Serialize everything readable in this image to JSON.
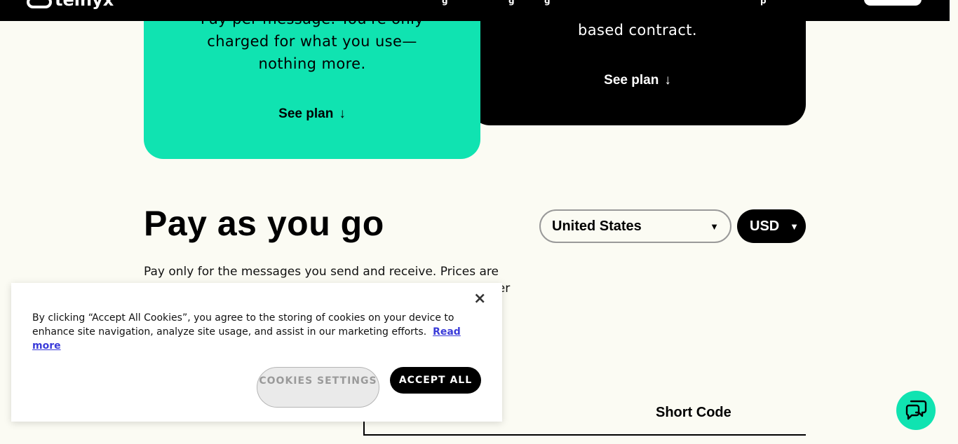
{
  "nav": {
    "logo_text": "telnyx",
    "fragments": [
      "g",
      "g",
      "g",
      "g",
      "p"
    ]
  },
  "cards": {
    "green": {
      "description": "Pay per message. You're only charged for what you use—nothing more.",
      "see_plan": "See plan",
      "arrow": "↓"
    },
    "black": {
      "description": "based contract.",
      "see_plan": "See plan",
      "arrow": "↓"
    }
  },
  "section": {
    "title": "Pay as you go",
    "description": "Pay only for the messages you send and receive. Prices are",
    "description_tail": "ber"
  },
  "selectors": {
    "country": "United States",
    "currency": "USD",
    "caret": "▼"
  },
  "tabs": {
    "partial": "e",
    "short_code": "Short Code"
  },
  "cookie_banner": {
    "text": "By clicking “Accept All Cookies”, you agree to the storing of cookies on your device to enhance site navigation, analyze site usage, and assist in our marketing efforts.",
    "read_more": "Read more",
    "settings_button": "COOKIES SETTINGS",
    "accept_button": "ACCEPT ALL",
    "close": "×"
  },
  "colors": {
    "accent_green": "#10e3b1",
    "page_bg": "#fbfbf3",
    "link_blue": "#3a3bd9"
  },
  "icons": {
    "chat": "chat-bubbles-icon",
    "close": "close-icon",
    "arrow": "arrow-down-icon"
  }
}
